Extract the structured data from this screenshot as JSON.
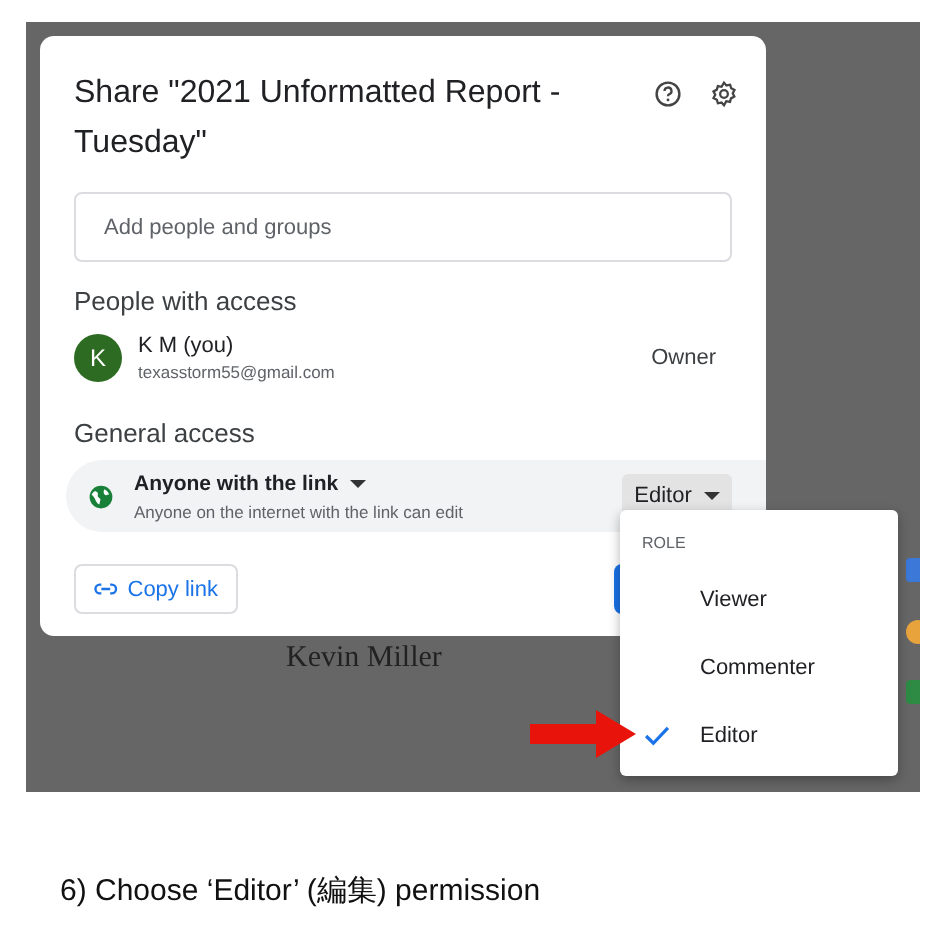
{
  "dialog": {
    "title": "Share \"2021 Unformatted Report - Tuesday\"",
    "search": {
      "placeholder": "Add people and groups"
    },
    "people_heading": "People with access",
    "people": [
      {
        "initial": "K",
        "name": "K M (you)",
        "email": "texasstorm55@gmail.com",
        "role": "Owner"
      }
    ],
    "general_heading": "General access",
    "access": {
      "scope": "Anyone with the link",
      "description": "Anyone on the internet with the link can edit",
      "role": "Editor"
    },
    "copy_link": "Copy link"
  },
  "role_menu": {
    "heading": "ROLE",
    "items": [
      {
        "label": "Viewer",
        "selected": false
      },
      {
        "label": "Commenter",
        "selected": false
      },
      {
        "label": "Editor",
        "selected": true
      }
    ]
  },
  "document_text": "Kevin Miller",
  "caption": "6) Choose ‘Editor’ (編集) permission"
}
